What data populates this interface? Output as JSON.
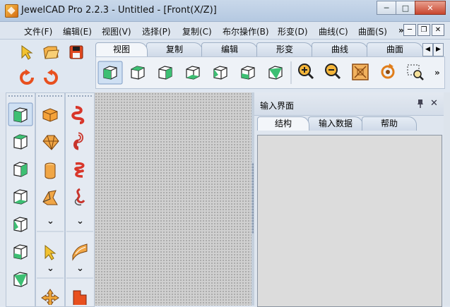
{
  "window": {
    "title": "JewelCAD Pro 2.2.3 - Untitled - [Front(X/Z)]",
    "minimize": "─",
    "maximize": "□",
    "close": "✕"
  },
  "menu": {
    "items": [
      "文件(F)",
      "编辑(E)",
      "视图(V)",
      "选择(P)",
      "复制(C)",
      "布尔操作(B)",
      "形变(D)",
      "曲线(C)",
      "曲面(S)"
    ],
    "overflow": "»",
    "mdi_minimize": "─",
    "mdi_restore": "❐",
    "mdi_close": "✕"
  },
  "ribbon_tabs": [
    "视图",
    "复制",
    "编辑",
    "形变",
    "曲线",
    "曲面"
  ],
  "ribbon_nav": {
    "left": "◀",
    "right": "▶"
  },
  "ribbon_overflow": "»",
  "input_panel": {
    "title": "输入界面",
    "pin": "📌",
    "close": "✕",
    "tabs": [
      "结构",
      "输入数据",
      "帮助"
    ]
  },
  "colors": {
    "accent_green": "#3dbf73",
    "orange": "#e8841c",
    "red": "#d8362a"
  },
  "collapse_arrow": "⌄"
}
